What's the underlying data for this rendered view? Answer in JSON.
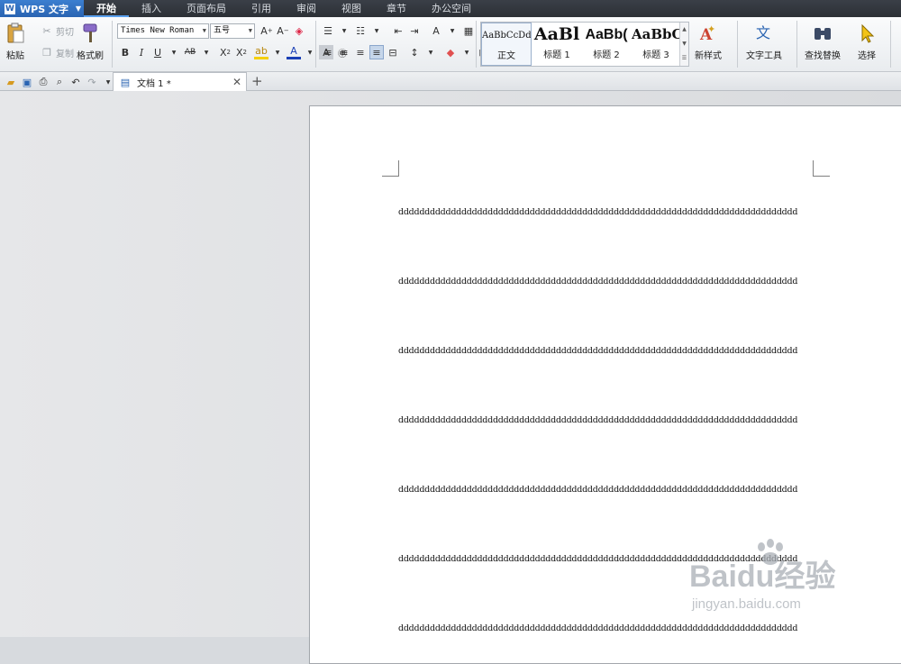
{
  "app": {
    "name": "WPS 文字"
  },
  "menu_tabs": [
    "开始",
    "插入",
    "页面布局",
    "引用",
    "审阅",
    "视图",
    "章节",
    "办公空间"
  ],
  "clipboard": {
    "paste": "粘贴",
    "cut": "剪切",
    "copy": "复制",
    "format_painter": "格式刷"
  },
  "font": {
    "name": "Times New Roman",
    "size": "五号"
  },
  "styles": [
    {
      "sample": "AaBbCcDd",
      "label": "正文"
    },
    {
      "sample": "AaBl",
      "label": "标题 1"
    },
    {
      "sample": "AaBb(",
      "label": "标题 2"
    },
    {
      "sample": "AaBbC",
      "label": "标题 3"
    }
  ],
  "tools": {
    "new_style": "新样式",
    "text_tools": "文字工具",
    "find_replace": "查找替换",
    "select": "选择"
  },
  "document_tab": {
    "title": "文档 1 *"
  },
  "document": {
    "paragraphs": [
      "dddddddddddddddddddddddddddddddddddddddddddddddddddddddddddddddddddddddddddd",
      "dddddddddddddddddddddddddddddddddddddddddddddddddddddddddddddddddddddddddddd",
      "dddddddddddddddddddddddddddddddddddddddddddddddddddddddddddddddddddddddddddd",
      "dddddddddddddddddddddddddddddddddddddddddddddddddddddddddddddddddddddddddddd",
      "dddddddddddddddddddddddddddddddddddddddddddddddddddddddddddddddddddddddddddd",
      "dddddddddddddddddddddddddddddddddddddddddddddddddddddddddddddddddddddddddddd",
      "dddddddddddddddddddddddddddddddddddddddddddddddddddddddddddddddddddddddddddd"
    ]
  },
  "watermark": {
    "brand": "Baidu经验",
    "url": "jingyan.baidu.com"
  },
  "colors": {
    "app_button": "#2a64b2",
    "menubar": "#2c3036",
    "font_color": "#1a3fb5",
    "highlight": "#f5d000",
    "shading": "#e05050"
  }
}
